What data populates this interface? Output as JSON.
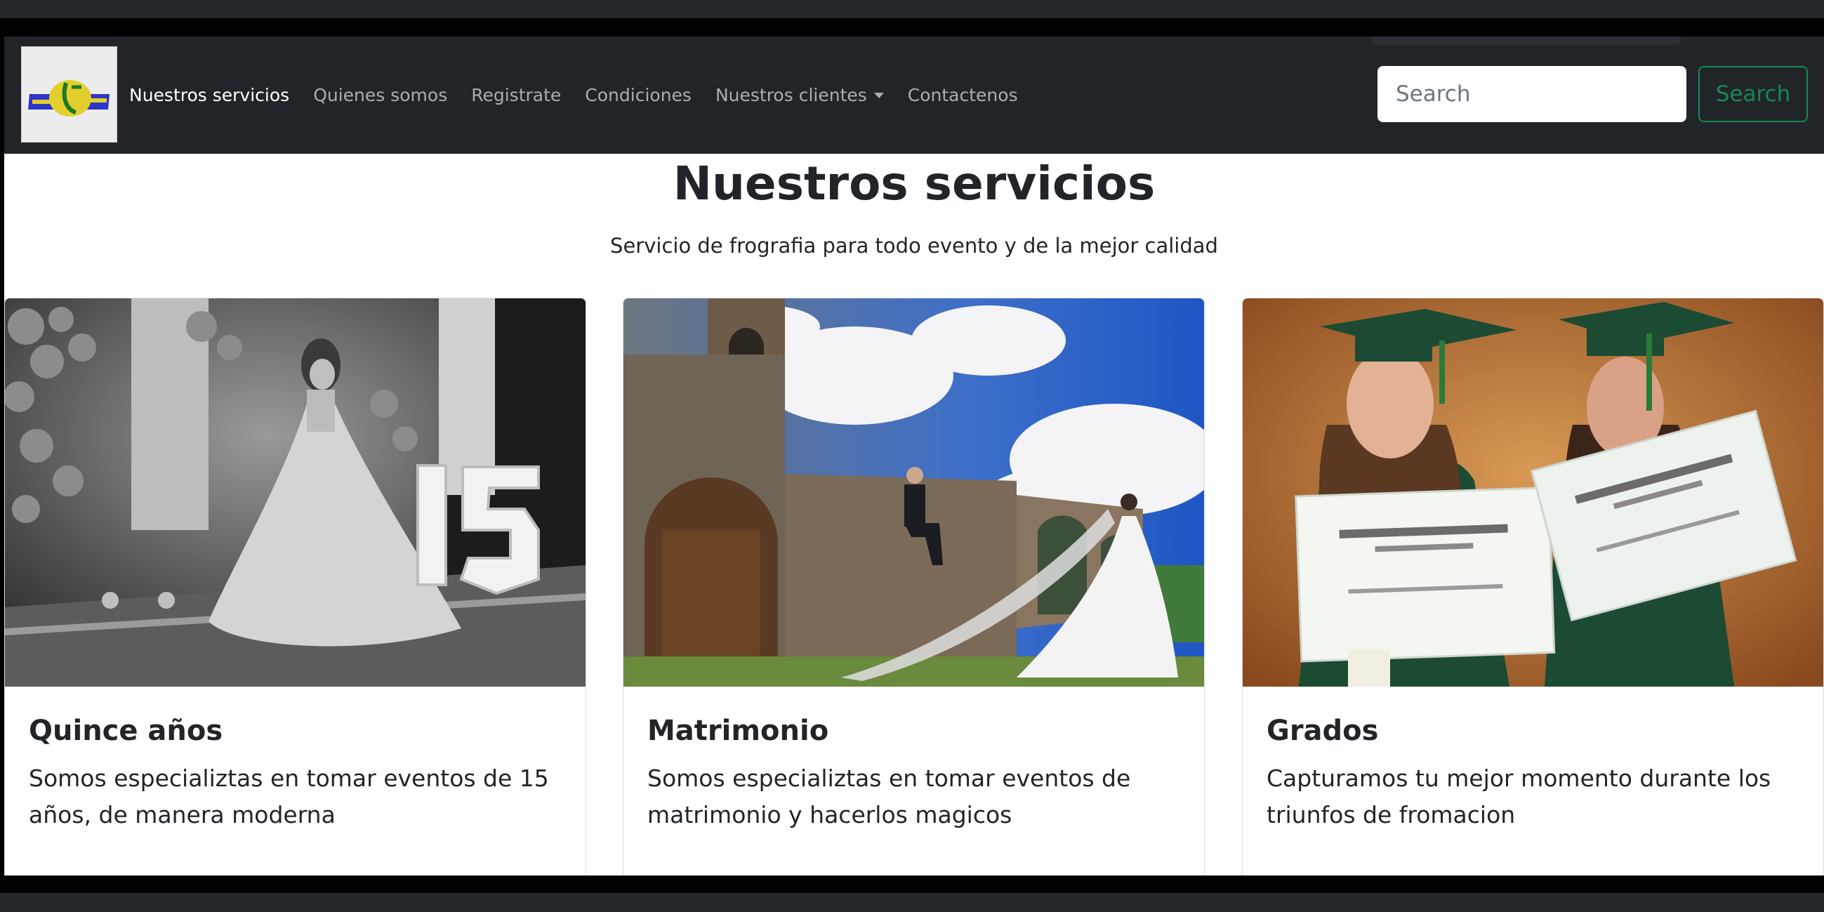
{
  "nav": {
    "logo_alt": "Fotografía logo",
    "links": [
      {
        "label": "Nuestros servicios",
        "active": true
      },
      {
        "label": "Quienes somos"
      },
      {
        "label": "Registrate"
      },
      {
        "label": "Condiciones"
      },
      {
        "label": "Nuestros clientes",
        "dropdown": true
      },
      {
        "label": "Contactenos"
      }
    ],
    "search": {
      "placeholder": "Search",
      "button_label": "Search"
    }
  },
  "main": {
    "title": "Nuestros servicios",
    "subtitle": "Servicio de frografia para todo evento y de la mejor calidad"
  },
  "cards": [
    {
      "title": "Quince años",
      "text": "Somos especializtas en tomar eventos de 15 años, de manera moderna",
      "image": "quinceanera-photo"
    },
    {
      "title": "Matrimonio",
      "text": "Somos especializtas en tomar eventos de matrimonio y hacerlos magicos",
      "image": "wedding-photo"
    },
    {
      "title": "Grados",
      "text": "Capturamos tu mejor momento durante los triunfos de fromacion",
      "image": "graduation-photo"
    }
  ],
  "colors": {
    "navbar": "#212529",
    "success": "#198754",
    "text": "#212529"
  }
}
